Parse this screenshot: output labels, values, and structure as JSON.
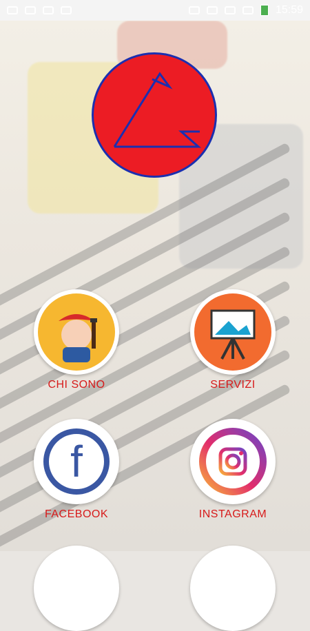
{
  "status_bar": {
    "time": "15:59"
  },
  "menu": [
    {
      "label": "CHI SONO",
      "icon": "painter-icon",
      "bg": "#f6b730"
    },
    {
      "label": "SERVIZI",
      "icon": "easel-icon",
      "bg": "#f26b2f"
    },
    {
      "label": "FACEBOOK",
      "icon": "facebook-icon",
      "bg": "#ffffff"
    },
    {
      "label": "INSTAGRAM",
      "icon": "instagram-icon",
      "bg": "#ffffff"
    }
  ],
  "colors": {
    "logo_red": "#ec1c24",
    "logo_blue": "#1b2fb0",
    "label_red": "#d71a1a"
  }
}
